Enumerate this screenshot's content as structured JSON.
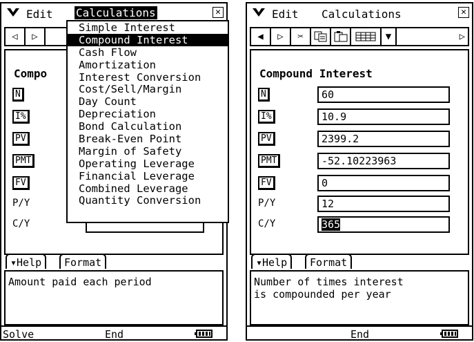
{
  "menubar": {
    "edit_label": "Edit",
    "calc_label": "Calculations",
    "close_glyph": "✕"
  },
  "left_screen": {
    "heading": "Compo",
    "variables": [
      {
        "label": "N",
        "value": ""
      },
      {
        "label": "I%",
        "value": ""
      },
      {
        "label": "PV",
        "value": ""
      },
      {
        "label": "PMT",
        "value": ""
      },
      {
        "label": "FV",
        "value": ""
      },
      {
        "label": "P/Y",
        "value": ""
      },
      {
        "label": "C/Y",
        "value": ""
      }
    ],
    "help_text": "Amount paid each period",
    "status_solve": "Solve",
    "status_end": "End"
  },
  "dropdown": {
    "items": [
      "Simple Interest",
      "Compound Interest",
      "Cash Flow",
      "Amortization",
      "Interest Conversion",
      "Cost/Sell/Margin",
      "Day Count",
      "Depreciation",
      "Bond Calculation",
      "Break-Even Point",
      "Margin of Safety",
      "Operating Leverage",
      "Financial Leverage",
      "Combined Leverage",
      "Quantity Conversion"
    ],
    "selected_index": 1
  },
  "right_screen": {
    "heading": "Compound Interest",
    "variables": [
      {
        "label": "N",
        "value": "60"
      },
      {
        "label": "I%",
        "value": "10.9"
      },
      {
        "label": "PV",
        "value": "2399.2"
      },
      {
        "label": "PMT",
        "value": "-52.10223963"
      },
      {
        "label": "FV",
        "value": "0"
      },
      {
        "label": "P/Y",
        "value": "12"
      },
      {
        "label": "C/Y",
        "value": "365"
      }
    ],
    "help_text_1": "Number of times interest",
    "help_text_2": "is compounded per year",
    "status_end": "End"
  },
  "tabs": {
    "help_label": "▾Help",
    "format_label": "Format"
  }
}
